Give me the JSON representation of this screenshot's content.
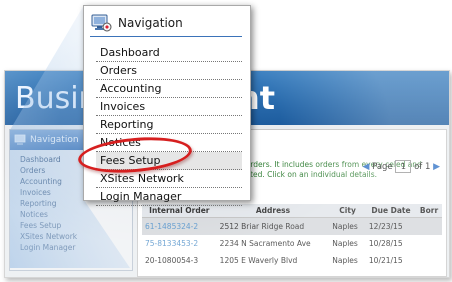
{
  "app": {
    "banner_title_left": "Busines",
    "banner_title_right": "nt",
    "sidebar": {
      "title": "Navigation",
      "items": [
        "Dashboard",
        "Orders",
        "Accounting",
        "Invoices",
        "Reporting",
        "Notices",
        "Fees Setup",
        "XSites Network",
        "Login Manager"
      ]
    },
    "panel": {
      "description": "en orders. It includes orders from every celed and deleted. Click on an individual details.",
      "pager": {
        "label": "Page",
        "page": "1",
        "of_label": "of 1"
      },
      "table": {
        "columns": [
          "Internal Order",
          "Address",
          "City",
          "Due Date",
          "Borr"
        ],
        "rows": [
          [
            "61-1485324-2",
            "2512 Briar Ridge Road",
            "Naples",
            "12/23/15",
            ""
          ],
          [
            "75-8133453-2",
            "2234 N Sacramento Ave",
            "Naples",
            "10/28/15",
            ""
          ],
          [
            "20-1080054-3",
            "1205 E Waverly Blvd",
            "Naples",
            "10/21/15",
            ""
          ]
        ]
      }
    }
  },
  "popup": {
    "title": "Navigation",
    "items": [
      {
        "label": "Dashboard"
      },
      {
        "label": "Orders"
      },
      {
        "label": "Accounting"
      },
      {
        "label": "Invoices"
      },
      {
        "label": "Reporting"
      },
      {
        "label": "Notices"
      },
      {
        "label": "Fees Setup"
      },
      {
        "label": "XSites Network"
      },
      {
        "label": "Login Manager"
      }
    ]
  },
  "colors": {
    "banner_blue": "#2a6db0",
    "highlight_ring": "#d61f1f",
    "menu_underline": "#3b73b9",
    "link_blue": "#4a8cc7",
    "description_green": "#2e7d32"
  },
  "icons": [
    "navigation-icon"
  ]
}
